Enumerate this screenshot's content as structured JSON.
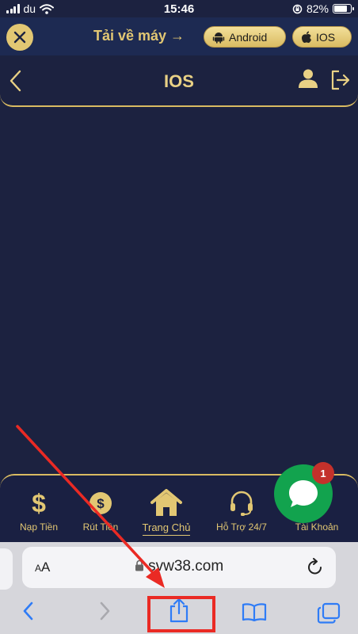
{
  "status_bar": {
    "carrier": "du",
    "time": "15:46",
    "battery": "82%",
    "battery_level": 0.82
  },
  "banner": {
    "download_label": "Tải về máy →",
    "android_label": "Android",
    "ios_label": "IOS"
  },
  "header": {
    "title": "IOS"
  },
  "bottom_nav": {
    "items": [
      {
        "label": "Nạp Tiền"
      },
      {
        "label": "Rút Tiền"
      },
      {
        "label": "Trang Chủ"
      },
      {
        "label": "Hỗ Trợ 24/7"
      },
      {
        "label": "Tài Khoản"
      }
    ]
  },
  "chat": {
    "badge_count": "1"
  },
  "safari": {
    "aa_label": "AA",
    "url": "svw38.com"
  },
  "colors": {
    "gold": "#e2c773",
    "navy": "#1c2240",
    "chat_green": "#12a34e",
    "highlight_red": "#ea2a24"
  }
}
